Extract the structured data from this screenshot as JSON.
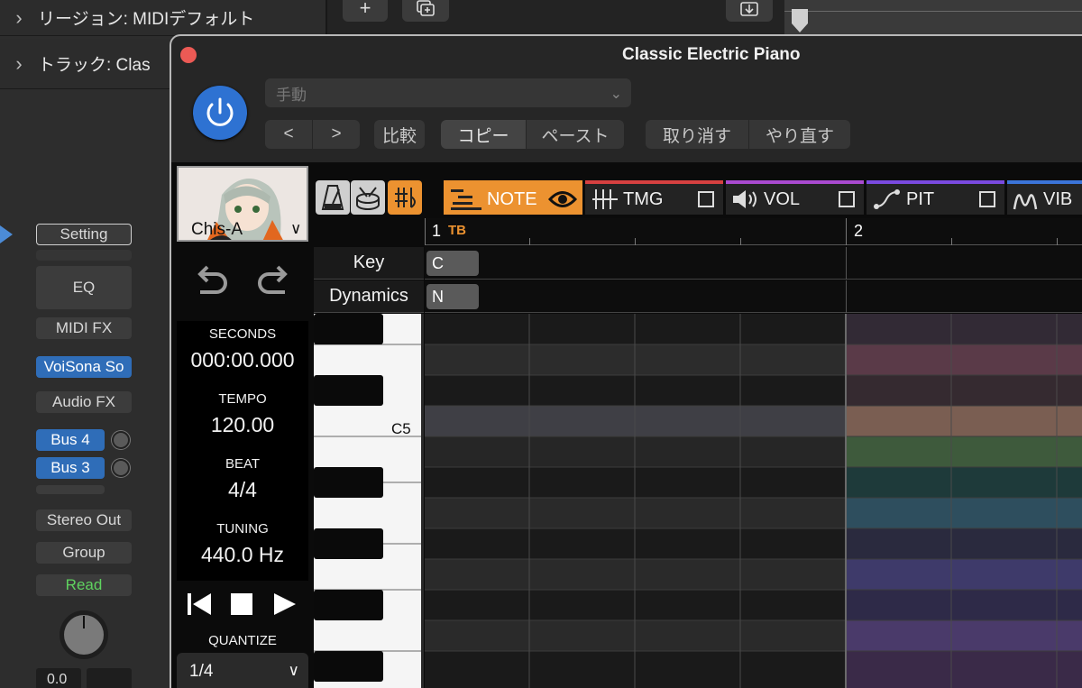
{
  "inspector": {
    "region_label": "リージョン: MIDIデフォルト",
    "track_label": "トラック: Clas"
  },
  "channel_strip": {
    "setting": "Setting",
    "eq": "EQ",
    "midi_fx": "MIDI FX",
    "instrument": "VoiSona So",
    "audio_fx": "Audio FX",
    "send1": "Bus 4",
    "send2": "Bus 3",
    "output": "Stereo Out",
    "group": "Group",
    "automation": "Read",
    "volume": "0.0"
  },
  "plugin": {
    "title": "Classic Electric Piano",
    "preset": "手動",
    "prev": "<",
    "next": ">",
    "compare": "比較",
    "copy": "コピー",
    "paste": "ペースト",
    "undo": "取り消す",
    "redo": "やり直す"
  },
  "voisona": {
    "singer": "Chis-A",
    "seconds_label": "SECONDS",
    "seconds": "000:00.000",
    "tempo_label": "TEMPO",
    "tempo": "120.00",
    "beat_label": "BEAT",
    "beat": "4/4",
    "tuning_label": "TUNING",
    "tuning": "440.0 Hz",
    "quantize_label": "QUANTIZE",
    "quantize": "1/4",
    "tabs": {
      "note": "NOTE",
      "tmg": "TMG",
      "vol": "VOL",
      "pit": "PIT",
      "vib": "VIB"
    },
    "ruler": {
      "bar1": "1",
      "tb": "TB",
      "bar2": "2"
    },
    "key_label": "Key",
    "key_value": "C",
    "dynamics_label": "Dynamics",
    "dynamics_value": "N",
    "c5_label": "C5"
  },
  "colors": {
    "accent_orange": "#ec9230",
    "power_blue": "#2e72d2",
    "tab_tmg": "#d64040",
    "tab_vol": "#a94ad0",
    "tab_pit": "#7a4ae0",
    "tab_vib": "#3b74d8"
  }
}
